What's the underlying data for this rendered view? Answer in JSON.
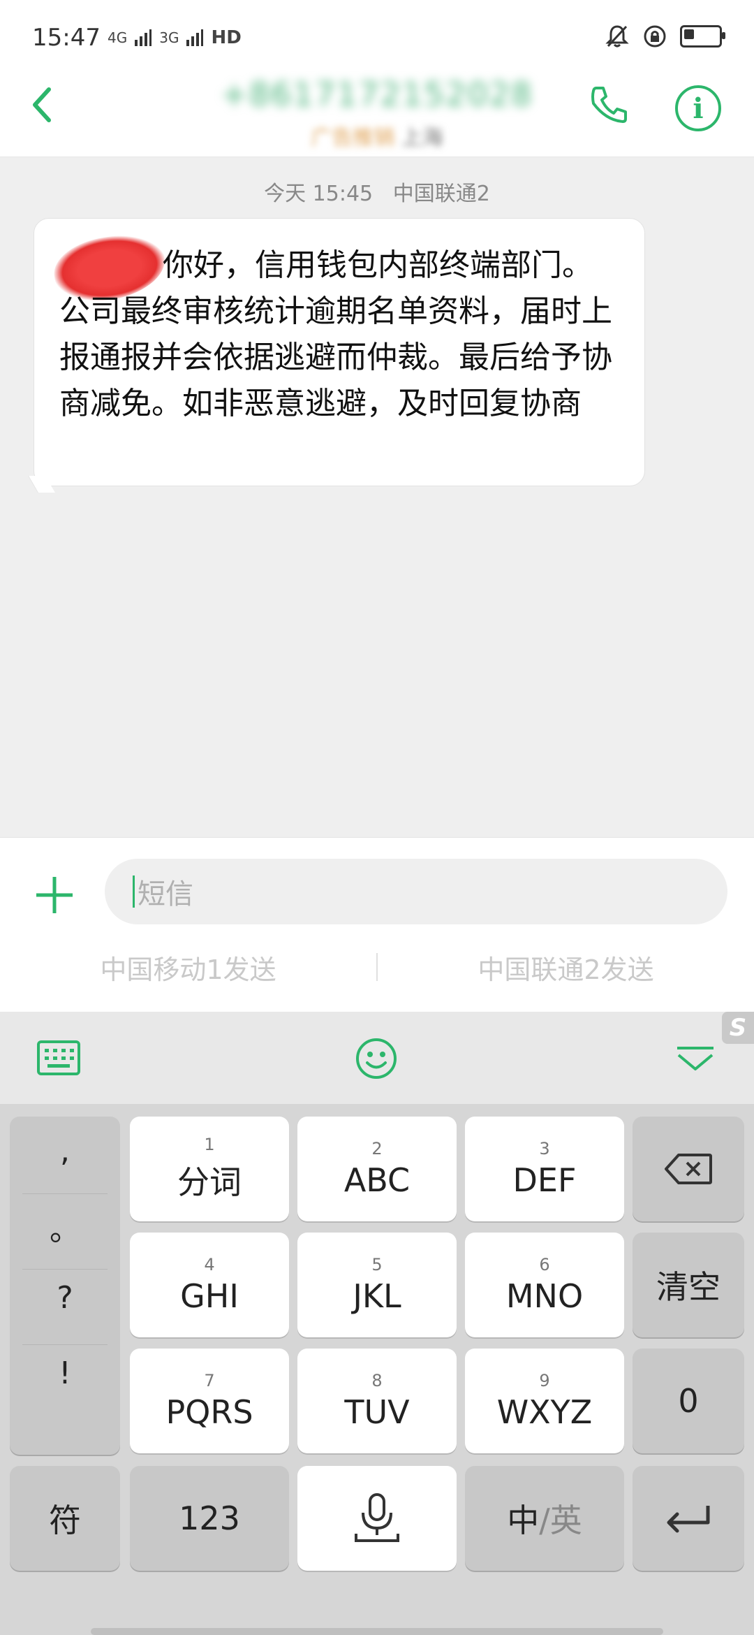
{
  "status_bar": {
    "time": "15:47",
    "signal_1": "4G",
    "signal_2": "3G",
    "hd": "HD"
  },
  "header": {
    "contact_number": "+8617172152028",
    "contact_tag": "广告推销",
    "contact_location": "上海"
  },
  "conversation": {
    "timestamp": "今天 15:45",
    "carrier": "中国联通2",
    "message": "你好，信用钱包内部终端部门。公司最终审核统计逾期名单资料，届时上报通报并会依据逃避而仲裁。最后给予协商减免。如非恶意逃避，及时回复协商"
  },
  "composer": {
    "placeholder": "短信",
    "send_sim1": "中国移动1发送",
    "send_sim2": "中国联通2发送"
  },
  "keyboard": {
    "logo": "S",
    "punct": [
      ",",
      "。",
      "?",
      "!"
    ],
    "keys_row1": [
      {
        "num": "1",
        "label": "分词"
      },
      {
        "num": "2",
        "label": "ABC"
      },
      {
        "num": "3",
        "label": "DEF"
      }
    ],
    "keys_row2": [
      {
        "num": "4",
        "label": "GHI"
      },
      {
        "num": "5",
        "label": "JKL"
      },
      {
        "num": "6",
        "label": "MNO"
      }
    ],
    "keys_row3": [
      {
        "num": "7",
        "label": "PQRS"
      },
      {
        "num": "8",
        "label": "TUV"
      },
      {
        "num": "9",
        "label": "WXYZ"
      }
    ],
    "clear_label": "清空",
    "zero_label": "0",
    "symbol_label": "符",
    "numeric_label": "123",
    "lang_label_cn": "中",
    "lang_label_sep": "/",
    "lang_label_en": "英"
  },
  "colors": {
    "accent": "#2cb66b",
    "bubble": "#ffffff",
    "background": "#efefef"
  }
}
